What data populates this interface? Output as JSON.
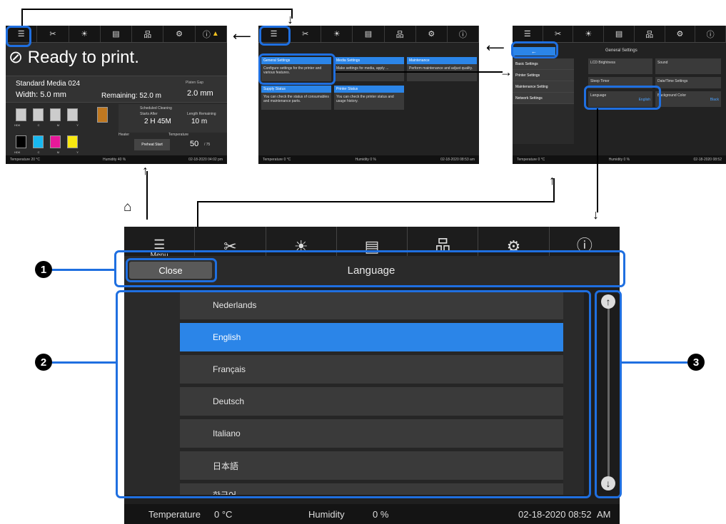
{
  "thumb1": {
    "ready_text": "Ready to print.",
    "media_name": "Standard Media 024",
    "width": "Width: 5.0 mm",
    "remaining": "Remaining: 52.0 m",
    "platen_label": "Platen Gap",
    "platen_value": "2.0 mm",
    "ink_labels_top": [
      "HDK",
      "C",
      "M",
      "Y"
    ],
    "ink_labels_bottom": [
      "HDK",
      "C",
      "M",
      "Y"
    ],
    "cleaning_label": "Scheduled Cleaning",
    "starts_after_label": "Starts After",
    "starts_after_value": "2 H 45M",
    "length_label": "Length Remaining",
    "length_value": "10 m",
    "heater_label": "Heater",
    "temperature_label": "Temperature",
    "preheat": "Preheat Start",
    "temp_value": "50",
    "temp_target": "/ 75",
    "status_temp": "Temperature  20 °C",
    "status_humidity": "Humidity   40 %",
    "status_time": "02-18-2020 04:02 pm",
    "menu_label": "Menu"
  },
  "thumb2": {
    "tiles": [
      {
        "title": "General Settings",
        "text": "Configure settings for the printer and various features."
      },
      {
        "title": "Media Settings",
        "text": "Make settings for media, apply ..."
      },
      {
        "title": "Maintenance",
        "text": "Perform maintenance and adjust quality."
      },
      {
        "title": "Supply Status",
        "text": "You can check the status of consumables and maintenance parts."
      },
      {
        "title": "Printer Status",
        "text": "You can check the printer status and usage history."
      }
    ],
    "status_temp": "Temperature  0 °C",
    "status_humidity": "Humidity   0 %",
    "status_time": "02-18-2020 08:53 am"
  },
  "thumb3": {
    "title": "General Settings",
    "back": "←",
    "side": [
      "Basic Settings",
      "Printer Settings",
      "Maintenance Setting",
      "Network Settings"
    ],
    "tiles": [
      {
        "title": "LCD Brightness",
        "value": ""
      },
      {
        "title": "Sound",
        "value": ""
      },
      {
        "title": "Sleep Timer",
        "value": ""
      },
      {
        "title": "Date/Time Settings",
        "value": ""
      },
      {
        "title": "Language",
        "value": "English"
      },
      {
        "title": "Background Color",
        "value": "Black"
      }
    ],
    "status_temp": "Temperature  0 °C",
    "status_humidity": "Humidity   0 %",
    "status_time": "02-18-2020 08:52"
  },
  "main": {
    "toolbar_menu_label": "Menu",
    "close_label": "Close",
    "title": "Language",
    "languages": [
      "Nederlands",
      "English",
      "Français",
      "Deutsch",
      "Italiano",
      "日本語"
    ],
    "partial_language": "한국어",
    "selected_language": "English",
    "status": {
      "temperature_label": "Temperature",
      "temperature_value": "0 °C",
      "humidity_label": "Humidity",
      "humidity_value": "0 %",
      "time": "02-18-2020 08:52",
      "ampm": "AM"
    }
  },
  "callouts": [
    "1",
    "2",
    "3"
  ],
  "colors": {
    "highlight": "#1f6fe0",
    "accent": "#2b85e8",
    "panel": "#2a2a2a"
  },
  "icons": [
    "menu-icon",
    "cutter-icon",
    "light-icon",
    "media-icon",
    "network-icon",
    "maintenance-icon",
    "info-icon",
    "warning-icon",
    "home-icon"
  ]
}
